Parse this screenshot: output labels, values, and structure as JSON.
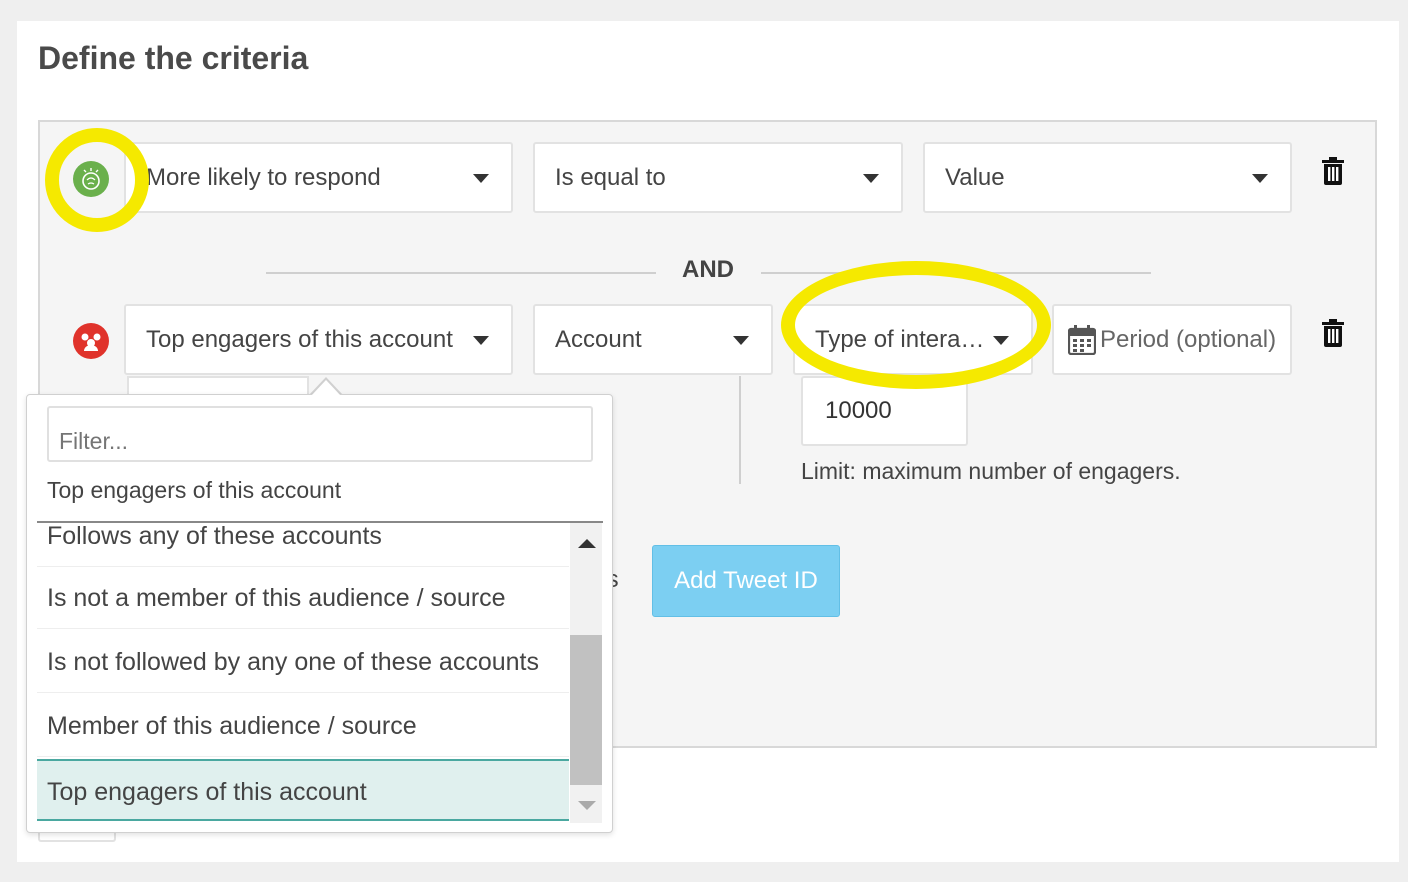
{
  "page": {
    "title": "Define the criteria"
  },
  "row1": {
    "attribute": "More likely to respond",
    "operator": "Is equal to",
    "value": "Value"
  },
  "connector": "AND",
  "row2": {
    "attribute": "Top engagers of this account",
    "account": "Account",
    "interaction": "Type of intera…",
    "period_placeholder": "Period (optional)",
    "limit_value": "10000",
    "limit_help": "Limit: maximum number of engagers.",
    "add_tweet_label": "Add Tweet ID",
    "partial_hidden_text": "ts"
  },
  "dropdown": {
    "filter_placeholder": "Filter...",
    "selected": "Top engagers of this account",
    "options": [
      "Follows any of these accounts",
      "Is not a member of this audience / source",
      "Is not followed by any one of these accounts",
      "Member of this audience / source",
      "Top engagers of this account"
    ],
    "active_index": 4
  },
  "colors": {
    "highlight": "#f5e900",
    "green_icon": "#6ab04c",
    "red_icon": "#e0332b",
    "button": "#7ccff2",
    "active_item": "#e0f0ee"
  }
}
